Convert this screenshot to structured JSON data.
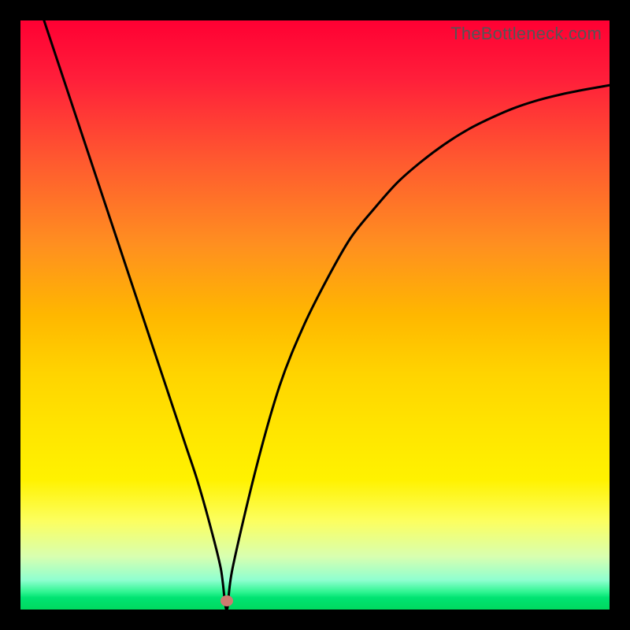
{
  "watermark": "TheBottleneck.com",
  "chart_data": {
    "type": "line",
    "title": "",
    "xlabel": "",
    "ylabel": "",
    "xlim": [
      0,
      100
    ],
    "ylim": [
      0,
      100
    ],
    "series": [
      {
        "name": "curve",
        "x": [
          4,
          8,
          12,
          16,
          20,
          24,
          28,
          30,
          32,
          34,
          35,
          36,
          40,
          44,
          48,
          52,
          56,
          60,
          64,
          68,
          72,
          76,
          80,
          84,
          88,
          92,
          96,
          100
        ],
        "y": [
          100,
          88,
          76,
          64,
          52,
          40,
          28,
          22,
          15,
          7,
          0,
          7,
          24,
          38,
          48,
          56,
          63,
          68,
          72.5,
          76,
          79,
          81.5,
          83.5,
          85.2,
          86.5,
          87.5,
          88.3,
          89
        ]
      }
    ],
    "marker": {
      "x": 35,
      "y": 1.5,
      "color": "#cc7b70"
    },
    "background_gradient": {
      "top": "#ff0033",
      "middle": "#ffe600",
      "bottom": "#00d95f"
    },
    "curve_color": "#000000"
  }
}
